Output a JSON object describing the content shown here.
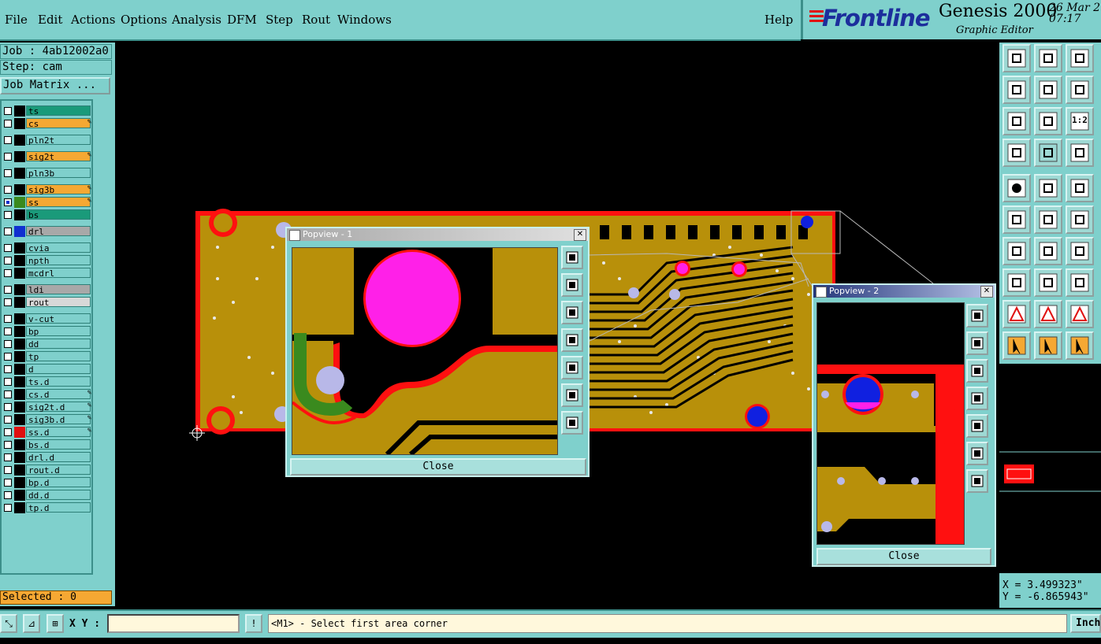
{
  "menubar": {
    "items": [
      "File",
      "Edit",
      "Actions",
      "Options",
      "Analysis",
      "DFM",
      "Step",
      "Rout",
      "Windows"
    ],
    "help": "Help"
  },
  "brand": {
    "logo": "Frontline",
    "product": "Genesis 2000",
    "subtitle": "Graphic Editor",
    "date": "26 Mar 2",
    "time": "07:17"
  },
  "job": {
    "job_label": "Job : 4ab12002a0",
    "step_label": "Step: cam",
    "matrix_button": "Job Matrix ..."
  },
  "layers": [
    {
      "name": "ts",
      "color": "#1a9a7a",
      "swatch": "#000",
      "editable": false
    },
    {
      "name": "cs",
      "color": "#f5a833",
      "swatch": "#000",
      "editable": true
    },
    {
      "name": "pln2t",
      "color": "#7fd0cc",
      "swatch": "#000",
      "editable": false
    },
    {
      "name": "sig2t",
      "color": "#f5a833",
      "swatch": "#000",
      "editable": true
    },
    {
      "name": "pln3b",
      "color": "#7fd0cc",
      "swatch": "#000",
      "editable": false
    },
    {
      "name": "sig3b",
      "color": "#f5a833",
      "swatch": "#000",
      "editable": true
    },
    {
      "name": "ss",
      "color": "#f5a833",
      "swatch": "#3a8a1e",
      "editable": true,
      "checked": true
    },
    {
      "name": "bs",
      "color": "#1a9a7a",
      "swatch": "#000",
      "editable": false
    },
    {
      "name": "drl",
      "color": "#a8a8a8",
      "swatch": "#1030d0",
      "editable": false
    },
    {
      "name": "cvia",
      "color": "#7fd0cc",
      "swatch": "#000",
      "editable": false
    },
    {
      "name": "npth",
      "color": "#7fd0cc",
      "swatch": "#000",
      "editable": false
    },
    {
      "name": "mcdrl",
      "color": "#7fd0cc",
      "swatch": "#000",
      "editable": false
    },
    {
      "name": "ldi",
      "color": "#a8a8a8",
      "swatch": "#000",
      "editable": false
    },
    {
      "name": "rout",
      "color": "#d8d8d8",
      "swatch": "#000",
      "editable": false
    },
    {
      "name": "v-cut",
      "color": "#7fd0cc",
      "swatch": "#000",
      "editable": false
    },
    {
      "name": "bp",
      "color": "#7fd0cc",
      "swatch": "#000",
      "editable": false
    },
    {
      "name": "dd",
      "color": "#7fd0cc",
      "swatch": "#000",
      "editable": false
    },
    {
      "name": "tp",
      "color": "#7fd0cc",
      "swatch": "#000",
      "editable": false
    },
    {
      "name": "d",
      "color": "#7fd0cc",
      "swatch": "#000",
      "editable": false
    },
    {
      "name": "ts.d",
      "color": "#7fd0cc",
      "swatch": "#000",
      "editable": false
    },
    {
      "name": "cs.d",
      "color": "#7fd0cc",
      "swatch": "#000",
      "editable": true
    },
    {
      "name": "sig2t.d",
      "color": "#7fd0cc",
      "swatch": "#000",
      "editable": true
    },
    {
      "name": "sig3b.d",
      "color": "#7fd0cc",
      "swatch": "#000",
      "editable": true
    },
    {
      "name": "ss.d",
      "color": "#7fd0cc",
      "swatch": "#e01010",
      "editable": true
    },
    {
      "name": "bs.d",
      "color": "#7fd0cc",
      "swatch": "#000",
      "editable": false
    },
    {
      "name": "drl.d",
      "color": "#7fd0cc",
      "swatch": "#000",
      "editable": false
    },
    {
      "name": "rout.d",
      "color": "#7fd0cc",
      "swatch": "#000",
      "editable": false
    },
    {
      "name": "bp.d",
      "color": "#7fd0cc",
      "swatch": "#000",
      "editable": false
    },
    {
      "name": "dd.d",
      "color": "#7fd0cc",
      "swatch": "#000",
      "editable": false
    },
    {
      "name": "tp.d",
      "color": "#7fd0cc",
      "swatch": "#000",
      "editable": false
    }
  ],
  "layer_edit_mark": "✎",
  "status": {
    "selected": "Selected : 0",
    "xy_label": "X Y :",
    "xy_value": "",
    "prompt": "<M1> - Select first area corner",
    "units": "Inch",
    "alert_glyph": "!"
  },
  "coords": {
    "x": "X = 3.499323\"",
    "y": "Y = -6.865943\""
  },
  "popview1": {
    "title": "Popview - 1",
    "close": "Close"
  },
  "popview2": {
    "title": "Popview - 2",
    "close": "Close"
  },
  "toolbar": {
    "one_to_two": "1:2",
    "icons": [
      "zoom-home-icon",
      "pan-up-icon",
      "home-icon",
      "pan-left-icon",
      "pan-right-icon",
      "undo-view-icon",
      "fit-icon",
      "center-icon",
      "ratio-icon",
      "tools-icon",
      "grid-icon",
      "layers-icon",
      "fill-icon",
      "draw-icon",
      "ruler-icon",
      "connect-icon",
      "delete-icon",
      "move-icon",
      "line-icon",
      "slash-icon",
      "rotate-icon",
      "pad-icon",
      "split-icon",
      "measure-icon",
      "tri1-icon",
      "tri2-icon",
      "tri3-icon",
      "select-icon",
      "select2-icon",
      "select3-icon"
    ]
  },
  "colors": {
    "panel": "#7fd0cc",
    "copper": "#b8900a",
    "outline": "#ff1010",
    "pad_magenta": "#ff20e8",
    "via": "#b8b8e8",
    "drill_blue": "#1020e0",
    "brand_blue": "#1c2e9c"
  }
}
